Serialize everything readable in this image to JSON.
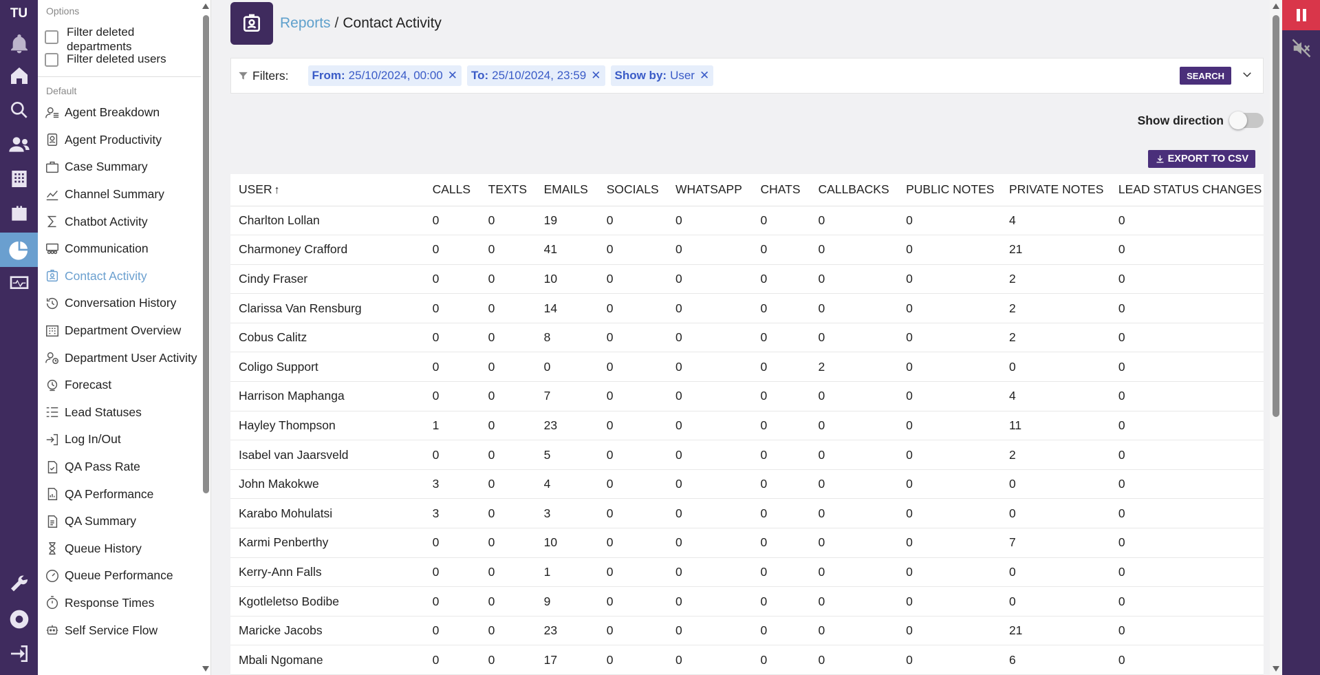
{
  "rail": {
    "logo": "TU"
  },
  "sidebar": {
    "options_label": "Options",
    "options": [
      {
        "label": "Filter deleted departments"
      },
      {
        "label": "Filter deleted users"
      }
    ],
    "default_label": "Default",
    "items": [
      {
        "label": "Agent Breakdown",
        "icon": "person-list-icon"
      },
      {
        "label": "Agent Productivity",
        "icon": "id-badge-icon"
      },
      {
        "label": "Case Summary",
        "icon": "briefcase-icon"
      },
      {
        "label": "Channel Summary",
        "icon": "line-chart-icon"
      },
      {
        "label": "Chatbot Activity",
        "icon": "sigma-icon"
      },
      {
        "label": "Communication",
        "icon": "people-group-icon"
      },
      {
        "label": "Contact Activity",
        "icon": "contact-badge-icon",
        "active": true
      },
      {
        "label": "Conversation History",
        "icon": "history-icon"
      },
      {
        "label": "Department Overview",
        "icon": "building-icon"
      },
      {
        "label": "Department User Activity",
        "icon": "user-clock-icon"
      },
      {
        "label": "Forecast",
        "icon": "forecast-icon"
      },
      {
        "label": "Lead Statuses",
        "icon": "list-status-icon"
      },
      {
        "label": "Log In/Out",
        "icon": "login-icon"
      },
      {
        "label": "QA Pass Rate",
        "icon": "document-check-icon"
      },
      {
        "label": "QA Performance",
        "icon": "document-chart-icon"
      },
      {
        "label": "QA Summary",
        "icon": "document-icon"
      },
      {
        "label": "Queue History",
        "icon": "hourglass-icon"
      },
      {
        "label": "Queue Performance",
        "icon": "gauge-icon"
      },
      {
        "label": "Response Times",
        "icon": "stopwatch-icon"
      },
      {
        "label": "Self Service Flow",
        "icon": "robot-icon"
      }
    ]
  },
  "header": {
    "breadcrumb_parent": "Reports",
    "breadcrumb_sep": "/",
    "title": "Contact Activity"
  },
  "filters": {
    "label": "Filters:",
    "chips": [
      {
        "key": "From:",
        "value": "25/10/2024, 00:00"
      },
      {
        "key": "To:",
        "value": "25/10/2024, 23:59"
      },
      {
        "key": "Show by:",
        "value": "User"
      }
    ],
    "search_label": "SEARCH"
  },
  "show_direction": {
    "label": "Show direction",
    "enabled": false
  },
  "export_label": "EXPORT TO CSV",
  "table": {
    "columns": [
      "USER",
      "CALLS",
      "TEXTS",
      "EMAILS",
      "SOCIALS",
      "WHATSAPP",
      "CHATS",
      "CALLBACKS",
      "PUBLIC NOTES",
      "PRIVATE NOTES",
      "LEAD STATUS CHANGES"
    ],
    "sort_indicator": "↑",
    "rows": [
      [
        "Charlton Lollan",
        "0",
        "0",
        "19",
        "0",
        "0",
        "0",
        "0",
        "0",
        "4",
        "0"
      ],
      [
        "Charmoney Crafford",
        "0",
        "0",
        "41",
        "0",
        "0",
        "0",
        "0",
        "0",
        "21",
        "0"
      ],
      [
        "Cindy Fraser",
        "0",
        "0",
        "10",
        "0",
        "0",
        "0",
        "0",
        "0",
        "2",
        "0"
      ],
      [
        "Clarissa Van Rensburg",
        "0",
        "0",
        "14",
        "0",
        "0",
        "0",
        "0",
        "0",
        "2",
        "0"
      ],
      [
        "Cobus Calitz",
        "0",
        "0",
        "8",
        "0",
        "0",
        "0",
        "0",
        "0",
        "2",
        "0"
      ],
      [
        "Coligo Support",
        "0",
        "0",
        "0",
        "0",
        "0",
        "0",
        "2",
        "0",
        "0",
        "0"
      ],
      [
        "Harrison Maphanga",
        "0",
        "0",
        "7",
        "0",
        "0",
        "0",
        "0",
        "0",
        "4",
        "0"
      ],
      [
        "Hayley Thompson",
        "1",
        "0",
        "23",
        "0",
        "0",
        "0",
        "0",
        "0",
        "11",
        "0"
      ],
      [
        "Isabel van Jaarsveld",
        "0",
        "0",
        "5",
        "0",
        "0",
        "0",
        "0",
        "0",
        "2",
        "0"
      ],
      [
        "John Makokwe",
        "3",
        "0",
        "4",
        "0",
        "0",
        "0",
        "0",
        "0",
        "0",
        "0"
      ],
      [
        "Karabo Mohulatsi",
        "3",
        "0",
        "3",
        "0",
        "0",
        "0",
        "0",
        "0",
        "0",
        "0"
      ],
      [
        "Karmi Penberthy",
        "0",
        "0",
        "10",
        "0",
        "0",
        "0",
        "0",
        "0",
        "7",
        "0"
      ],
      [
        "Kerry-Ann Falls",
        "0",
        "0",
        "1",
        "0",
        "0",
        "0",
        "0",
        "0",
        "0",
        "0"
      ],
      [
        "Kgotleletso Bodibe",
        "0",
        "0",
        "9",
        "0",
        "0",
        "0",
        "0",
        "0",
        "0",
        "0"
      ],
      [
        "Maricke Jacobs",
        "0",
        "0",
        "23",
        "0",
        "0",
        "0",
        "0",
        "0",
        "21",
        "0"
      ],
      [
        "Mbali Ngomane",
        "0",
        "0",
        "17",
        "0",
        "0",
        "0",
        "0",
        "0",
        "6",
        "0"
      ]
    ]
  }
}
